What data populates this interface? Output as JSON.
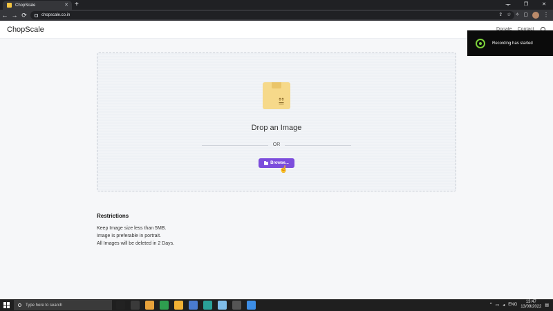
{
  "browser": {
    "tab_title": "ChopScale",
    "tab_close": "✕",
    "new_tab": "+",
    "url": "chopscale.co.in",
    "window_controls": [
      "—",
      "❐",
      "✕"
    ],
    "tab_list_chevron": "⌄",
    "nav": {
      "back": "←",
      "forward": "→",
      "reload": "⟳"
    },
    "toolbar_icons": [
      "⇪",
      "☆",
      "✧",
      "▢",
      "⋮"
    ]
  },
  "site": {
    "brand": "ChopScale",
    "nav_links": [
      "Donate",
      "Contact"
    ]
  },
  "upload": {
    "drop_title": "Drop an Image",
    "or_text": "OR",
    "browse_label": "Browse...",
    "box_color": "#f6d98a"
  },
  "restrictions": {
    "title": "Restrictions",
    "items": [
      "Keep Image size less than 5MB.",
      "Image is preferable in portrait.",
      "All Images will be deleted in 2 Days."
    ]
  },
  "toast": {
    "message": "Recording has started",
    "accent": "#7cd13a"
  },
  "taskbar": {
    "search_placeholder": "Type here to search",
    "language": "ENG",
    "time": "13:47",
    "date": "13/09/2022",
    "app_icon_colors": [
      "#222222",
      "#3a3a3a",
      "#e8a33b",
      "#2e9e4f",
      "#f2b134",
      "#4a7bd0",
      "#2aa198",
      "#7fbde9",
      "#555555",
      "#3d8ee6"
    ]
  },
  "colors": {
    "accent_purple": "#7c4ddc"
  }
}
